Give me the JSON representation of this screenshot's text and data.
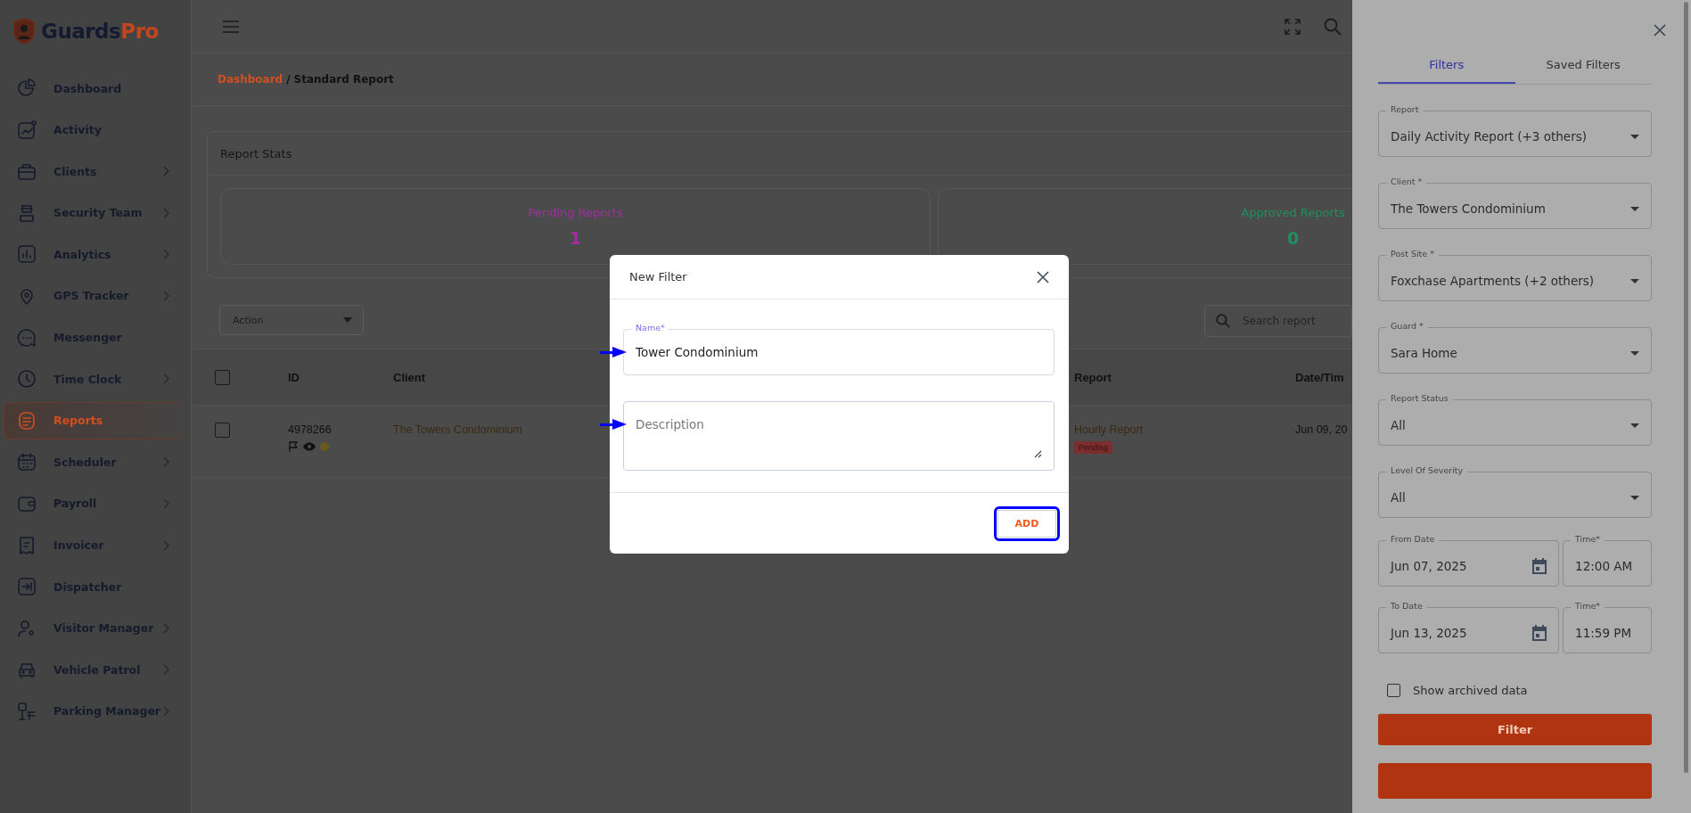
{
  "logo": {
    "main": "Guards",
    "accent": "Pro"
  },
  "sidebar": {
    "items": [
      {
        "label": "Dashboard",
        "has_submenu": false,
        "selected": false
      },
      {
        "label": "Activity",
        "has_submenu": false,
        "selected": false
      },
      {
        "label": "Clients",
        "has_submenu": true,
        "selected": false
      },
      {
        "label": "Security Team",
        "has_submenu": true,
        "selected": false
      },
      {
        "label": "Analytics",
        "has_submenu": true,
        "selected": false
      },
      {
        "label": "GPS Tracker",
        "has_submenu": true,
        "selected": false
      },
      {
        "label": "Messenger",
        "has_submenu": false,
        "selected": false
      },
      {
        "label": "Time Clock",
        "has_submenu": true,
        "selected": false
      },
      {
        "label": "Reports",
        "has_submenu": false,
        "selected": true
      },
      {
        "label": "Scheduler",
        "has_submenu": true,
        "selected": false
      },
      {
        "label": "Payroll",
        "has_submenu": true,
        "selected": false
      },
      {
        "label": "Invoicer",
        "has_submenu": true,
        "selected": false
      },
      {
        "label": "Dispatcher",
        "has_submenu": false,
        "selected": false
      },
      {
        "label": "Visitor Manager",
        "has_submenu": true,
        "selected": false
      },
      {
        "label": "Vehicle Patrol",
        "has_submenu": true,
        "selected": false
      },
      {
        "label": "Parking Manager",
        "has_submenu": true,
        "selected": false
      }
    ]
  },
  "breadcrumb": {
    "parent": "Dashboard",
    "separator": "/",
    "current": "Standard Report"
  },
  "report_stats": {
    "title": "Report Stats",
    "stats": [
      {
        "label": "Pending Reports",
        "value": "1",
        "color": "#a02ea0"
      },
      {
        "label": "Approved Reports",
        "value": "0",
        "color": "#1f8f5f"
      }
    ]
  },
  "toolbar": {
    "action": {
      "placeholder": "Action"
    },
    "search": {
      "placeholder": "Search report"
    }
  },
  "table": {
    "all_selected": false,
    "columns": [
      "ID",
      "Client",
      "Report",
      "Date/Tim"
    ],
    "rows": [
      {
        "selected": false,
        "id": "4978266",
        "client": "The Towers Condominium",
        "report": "Hourly Report",
        "status": "Pending",
        "date": "Jun 09, 20"
      }
    ]
  },
  "filter_panel": {
    "tabs": [
      {
        "label": "Filters",
        "selected": true
      },
      {
        "label": "Saved Filters",
        "selected": false
      }
    ],
    "fields": [
      {
        "label": "Report",
        "value": "Daily Activity Report (+3 others)"
      },
      {
        "label": "Client *",
        "value": "The Towers Condominium"
      },
      {
        "label": "Post Site *",
        "value": "Foxchase Apartments (+2 others)"
      },
      {
        "label": "Guard *",
        "value": "Sara Home"
      },
      {
        "label": "Report Status",
        "value": "All"
      },
      {
        "label": "Level Of Severity",
        "value": "All"
      }
    ],
    "date_ranges": [
      {
        "date_label": "From Date",
        "date": "Jun 07, 2025",
        "time_label": "Time*",
        "time": "12:00 AM"
      },
      {
        "date_label": "To Date",
        "date": "Jun 13, 2025",
        "time_label": "Time*",
        "time": "11:59 PM"
      }
    ],
    "show_archived": {
      "label": "Show archived data",
      "checked": false
    },
    "filter_button": "Filter"
  },
  "modal": {
    "title": "New Filter",
    "fields": [
      {
        "kind": "input",
        "label": "Name*",
        "value": "Tower Condominium",
        "annotated": true
      },
      {
        "kind": "textarea",
        "placeholder": "Description",
        "annotated": true
      }
    ],
    "button": {
      "label": "ADD",
      "highlighted": true
    }
  }
}
